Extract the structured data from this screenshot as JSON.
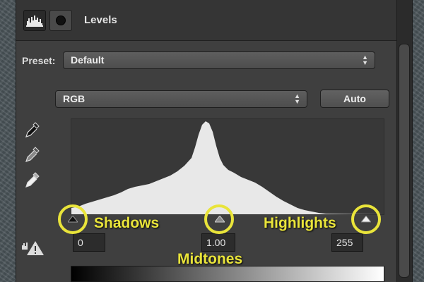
{
  "panel": {
    "title": "Levels",
    "header_icons": [
      "levels-histogram-icon",
      "layer-mask-icon"
    ]
  },
  "preset": {
    "label": "Preset:",
    "value": "Default"
  },
  "channel": {
    "value": "RGB",
    "auto_label": "Auto"
  },
  "eyedroppers": [
    "black-point-eyedropper-icon",
    "gray-point-eyedropper-icon",
    "white-point-eyedropper-icon"
  ],
  "input_levels": {
    "shadows": "0",
    "midtones": "1.00",
    "highlights": "255"
  },
  "annotations": {
    "shadows": "Shadows",
    "midtones": "Midtones",
    "highlights": "Highlights"
  },
  "colors": {
    "annotation": "#e9e43a",
    "histogram_fill": "#e8e8e8",
    "panel_bg": "#3f3f3f"
  }
}
